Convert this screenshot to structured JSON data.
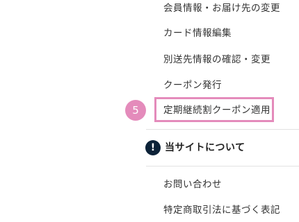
{
  "account_menu": {
    "items": [
      {
        "label": "会員情報・お届け先の変更"
      },
      {
        "label": "カード情報編集"
      },
      {
        "label": "別送先情報の確認・変更"
      },
      {
        "label": "クーポン発行"
      },
      {
        "label": "定期継続割クーポン適用"
      }
    ]
  },
  "highlight": {
    "step_number": "5",
    "color": "#e48bbb"
  },
  "about_section": {
    "icon": "exclamation-icon",
    "title": "当サイトについて",
    "items": [
      {
        "label": "お問い合わせ"
      },
      {
        "label": "特定商取引法に基づく表記"
      }
    ]
  }
}
